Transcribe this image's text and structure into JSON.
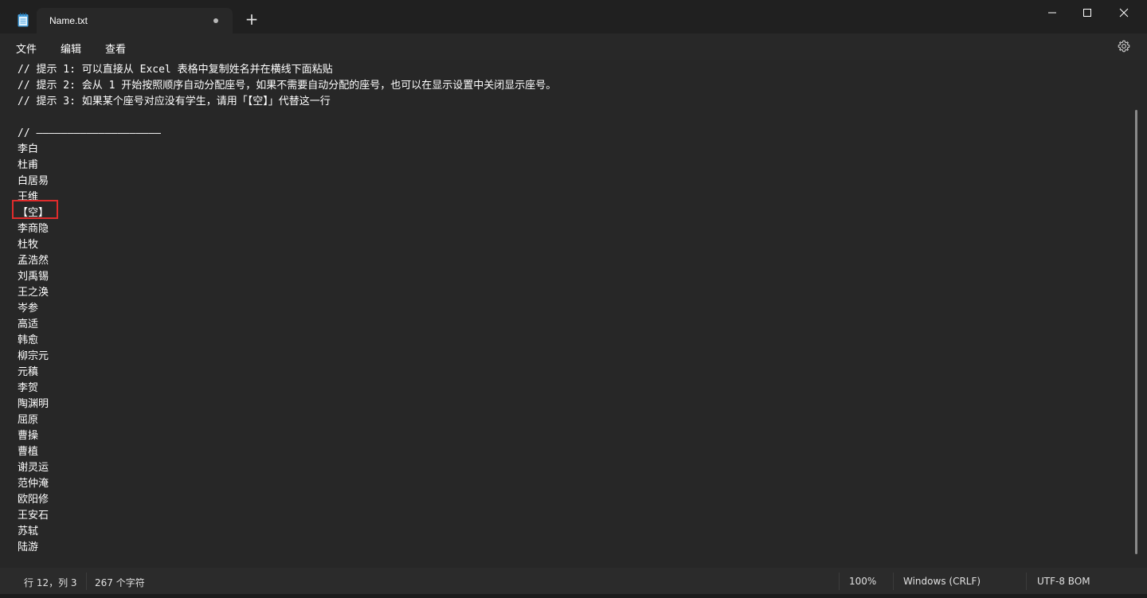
{
  "tab": {
    "title": "Name.txt",
    "new_tab_glyph": "+"
  },
  "menu": {
    "file": "文件",
    "edit": "编辑",
    "view": "查看"
  },
  "editor": {
    "lines": [
      "// 提示 1: 可以直接从 Excel 表格中复制姓名并在横线下面粘贴",
      "// 提示 2: 会从 1 开始按照顺序自动分配座号，如果不需要自动分配的座号，也可以在显示设置中关闭显示座号。",
      "// 提示 3: 如果某个座号对应没有学生，请用「【空】」代替这一行",
      "",
      "// ————————————————————",
      "李白",
      "杜甫",
      "白居易",
      "王维",
      "【空】",
      "李商隐",
      "杜牧",
      "孟浩然",
      "刘禹锡",
      "王之涣",
      "岑参",
      "高适",
      "韩愈",
      "柳宗元",
      "元稹",
      "李贺",
      "陶渊明",
      "屈原",
      "曹操",
      "曹植",
      "谢灵运",
      "范仲淹",
      "欧阳修",
      "王安石",
      "苏轼",
      "陆游"
    ]
  },
  "status": {
    "position": "行 12，列 3",
    "char_count": "267 个字符",
    "zoom": "100%",
    "line_ending": "Windows (CRLF)",
    "encoding": "UTF-8 BOM"
  },
  "icons": {
    "app": "notepad-icon",
    "settings": "gear-icon",
    "minimize": "minimize-icon",
    "maximize": "maximize-icon",
    "close": "close-icon"
  },
  "colors": {
    "highlight": "#e02c2c",
    "background": "#202020",
    "editor": "#272727"
  }
}
